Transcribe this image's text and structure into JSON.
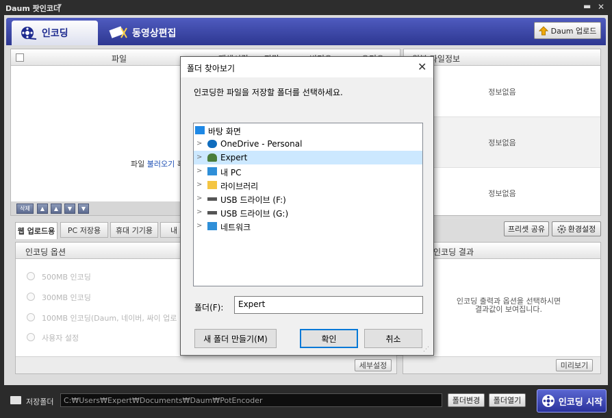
{
  "app": {
    "title": "Daum 팟인코더",
    "title_arrow": "▼",
    "minimize": "▬",
    "close": "✕"
  },
  "tabs": {
    "encode": "인코딩",
    "video_edit": "동영상편집"
  },
  "daum_upload": "Daum 업로드",
  "filelist": {
    "columns": [
      "파일",
      "재생시간",
      "자막",
      "비디오",
      "오디오"
    ],
    "hint_prefix": "파일 ",
    "hint_link": "불러오기",
    "hint_suffix": " 혹",
    "delete_label": "삭제",
    "nav_icons": [
      "▲",
      "▲",
      "▼",
      "▼"
    ]
  },
  "info": {
    "header": "원본 파일정보",
    "rows": [
      "정보없음",
      "정보없음",
      "정보없음"
    ]
  },
  "subtabs": [
    "웹 업로드용",
    "PC 저장용",
    "휴대 기기용",
    "내"
  ],
  "preset_share": "프리셋 공유",
  "settings": "환경설정",
  "options": {
    "header": "인코딩 옵션",
    "items": [
      "500MB 인코딩",
      "300MB 인코딩",
      "100MB 인코딩(Daum, 네이버, 싸이 업로",
      "사용자 설정"
    ],
    "detail_button": "세부설정"
  },
  "result": {
    "header": "인코딩 결과",
    "hint_line1": "인코딩 출력과 옵션을 선택하시면",
    "hint_line2": "결과값이 보여집니다.",
    "preview_button": "미리보기"
  },
  "bottom": {
    "save_folder_label": "저장폴더",
    "save_path": "C:₩Users₩Expert₩Documents₩Daum₩PotEncoder",
    "change_folder": "폴더변경",
    "open_folder": "폴더열기",
    "start_encode": "인코딩 시작"
  },
  "dialog": {
    "title": "폴더 찾아보기",
    "close": "✕",
    "instruction": "인코딩한 파일을 저장할 폴더를 선택하세요.",
    "tree": [
      {
        "label": "바탕 화면",
        "icon": "desktop-icon",
        "color": "#1e88e5"
      },
      {
        "label": "OneDrive - Personal",
        "icon": "cloud-icon",
        "color": "#0f6cbd"
      },
      {
        "label": "Expert",
        "icon": "user-icon",
        "color": "#4a7d3a"
      },
      {
        "label": "내 PC",
        "icon": "computer-icon",
        "color": "#2f8fd8"
      },
      {
        "label": "라이브러리",
        "icon": "library-folder-icon",
        "color": "#f4c542"
      },
      {
        "label": "USB 드라이브 (F:)",
        "icon": "usb-drive-icon",
        "color": "#555555"
      },
      {
        "label": "USB 드라이브 (G:)",
        "icon": "usb-drive-icon",
        "color": "#555555"
      },
      {
        "label": "네트워크",
        "icon": "network-icon",
        "color": "#2f8fd8"
      }
    ],
    "folder_label": "폴더(F):",
    "folder_value": "Expert",
    "new_folder": "새 폴더 만들기(M)",
    "ok": "확인",
    "cancel": "취소"
  },
  "colors": {
    "accent": "#2d3791",
    "selection": "#cce8ff",
    "ok_border": "#0078d7"
  }
}
